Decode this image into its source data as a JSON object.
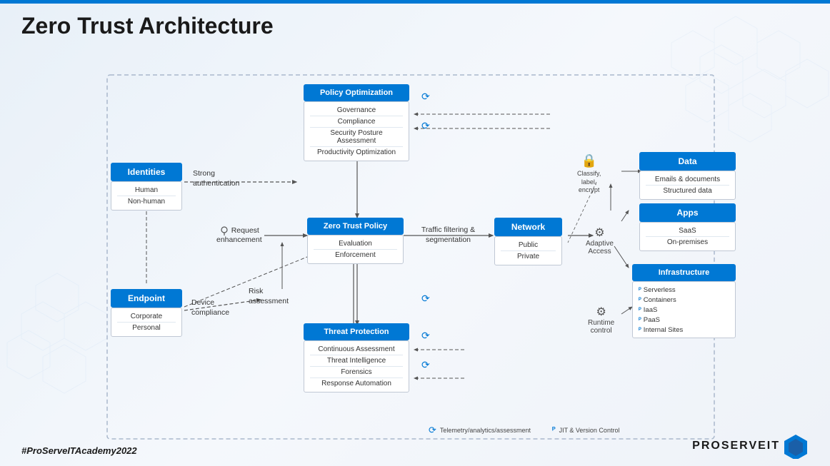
{
  "page": {
    "title": "Zero Trust Architecture",
    "footer_hashtag": "#ProServeITAcademy2022",
    "logo_text": "PROSERVEIT"
  },
  "boxes": {
    "policy_optimization": {
      "title": "Policy Optimization",
      "items": [
        "Governance",
        "Compliance",
        "Security Posture Assessment",
        "Productivity Optimization"
      ]
    },
    "identities": {
      "title": "Identities",
      "items": [
        "Human",
        "Non-human"
      ]
    },
    "endpoint": {
      "title": "Endpoint",
      "items": [
        "Corporate",
        "Personal"
      ]
    },
    "zero_trust_policy": {
      "title": "Zero Trust Policy",
      "items": [
        "Evaluation",
        "Enforcement"
      ]
    },
    "network": {
      "title": "Network",
      "items": [
        "Public",
        "Private"
      ]
    },
    "data": {
      "title": "Data",
      "items": [
        "Emails & documents",
        "Structured data"
      ]
    },
    "apps": {
      "title": "Apps",
      "items": [
        "SaaS",
        "On-premises"
      ]
    },
    "infrastructure": {
      "title": "Infrastructure",
      "items": [
        "Serverless",
        "Containers",
        "IaaS",
        "PaaS",
        "Internal Sites"
      ]
    },
    "threat_protection": {
      "title": "Threat Protection",
      "items": [
        "Continuous Assessment",
        "Threat Intelligence",
        "Forensics",
        "Response Automation"
      ]
    }
  },
  "labels": {
    "strong_authentication": "Strong\nauthentication",
    "request_enhancement": "Request\nenhancement",
    "device_compliance": "Device\ncompliance",
    "risk_assessment": "Risk\nassessment",
    "traffic_filtering": "Traffic filtering &\nsegmentation",
    "classify_label_encrypt": "Classify,\nlabel,\nencrypt",
    "adaptive_access": "Adaptive\nAccess",
    "runtime_control": "Runtime\ncontrol",
    "telemetry": "Telemetry/analytics/assessment",
    "jit": "JIT & Version Control"
  },
  "colors": {
    "blue": "#0078d4",
    "white": "#ffffff",
    "border": "#c0c8d4",
    "dashed": "#aab8cc",
    "text_dark": "#1a1a1a",
    "text_mid": "#333333"
  }
}
